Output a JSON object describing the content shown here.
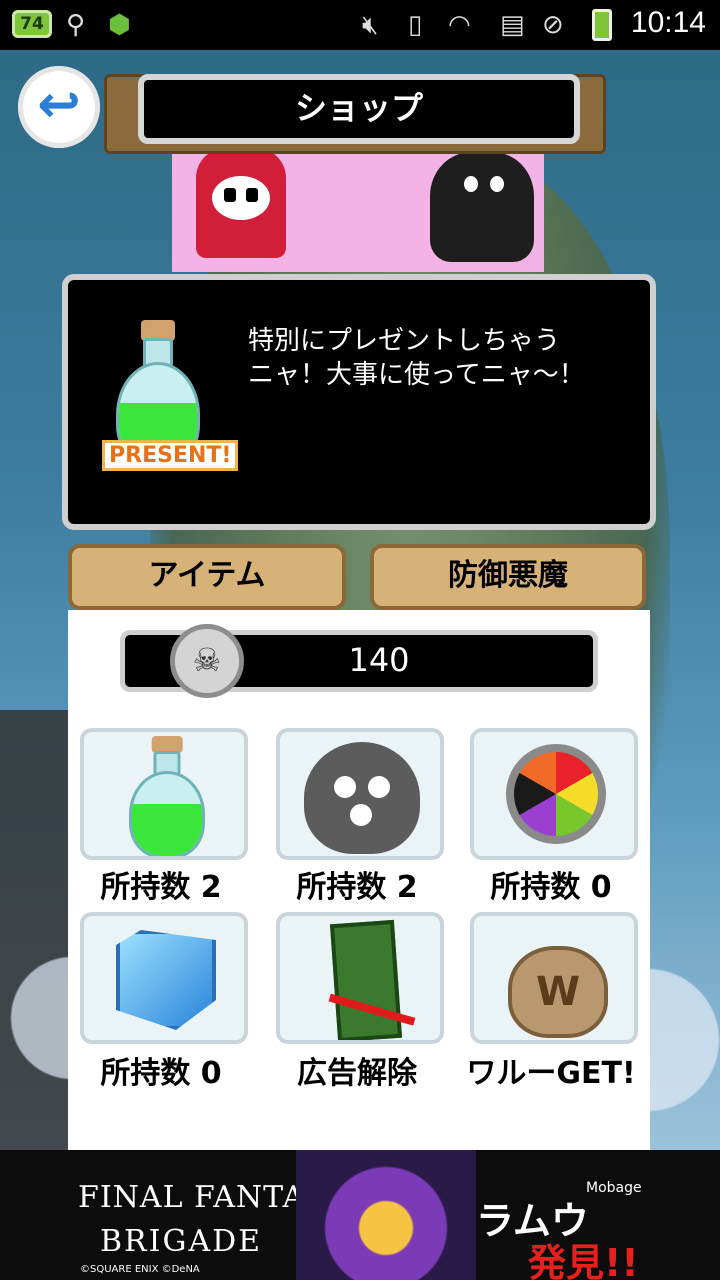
{
  "status_bar": {
    "battery_left": "74",
    "time": "10:14"
  },
  "header": {
    "title": "ショップ",
    "back_icon": "back-arrow-icon"
  },
  "message": {
    "text_line1": "特別にプレゼントしちゃう",
    "text_line2": "ニャ！大事に使ってニャ〜！",
    "present_label": "PRESENT!"
  },
  "tabs": [
    {
      "label": "アイテム"
    },
    {
      "label": "防御悪魔"
    }
  ],
  "currency": {
    "amount": "140",
    "icon": "skull-coin-icon"
  },
  "items": [
    {
      "label": "所持数 2",
      "icon": "potion-icon"
    },
    {
      "label": "所持数 2",
      "icon": "cat-skull-gauge-icon"
    },
    {
      "label": "所持数 0",
      "icon": "color-wheel-icon"
    },
    {
      "label": "所持数 0",
      "icon": "ice-gem-icon"
    },
    {
      "label": "広告解除",
      "icon": "ad-remove-icon"
    },
    {
      "label": "ワルーGET!",
      "icon": "money-bag-icon"
    }
  ],
  "ad_banner": {
    "line1": "FINAL FANTASY.",
    "line2": "BRIGADE",
    "copyright": "©SQUARE ENIX ©DeNA",
    "char_text": "ラムウ",
    "found_text": "発見!!",
    "mobage": "Mobage"
  }
}
